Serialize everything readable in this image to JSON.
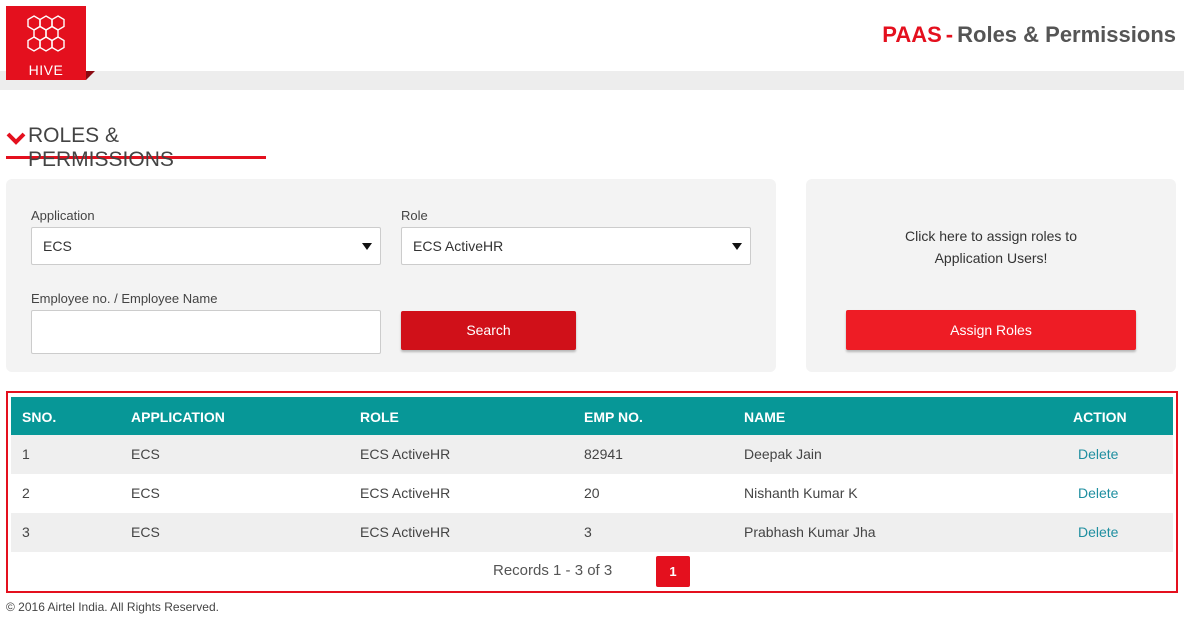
{
  "header": {
    "logo_text": "HIVE",
    "title_brand": "PAAS",
    "title_separator": "-",
    "title_text": "Roles & Permissions"
  },
  "section": {
    "title": "ROLES & PERMISSIONS"
  },
  "filters": {
    "application_label": "Application",
    "application_value": "ECS",
    "role_label": "Role",
    "role_value": "ECS ActiveHR",
    "employee_label": "Employee no. / Employee Name",
    "employee_value": "",
    "search_label": "Search"
  },
  "assign": {
    "text_line1": "Click here to assign roles to",
    "text_line2": "Application Users!",
    "button_label": "Assign Roles"
  },
  "table": {
    "columns": [
      "SNO.",
      "APPLICATION",
      "ROLE",
      "EMP NO.",
      "NAME",
      "ACTION"
    ],
    "rows": [
      {
        "sno": "1",
        "application": "ECS",
        "role": "ECS ActiveHR",
        "emp_no": "82941",
        "name": "Deepak Jain",
        "action": "Delete"
      },
      {
        "sno": "2",
        "application": "ECS",
        "role": "ECS ActiveHR",
        "emp_no": "20",
        "name": "Nishanth Kumar K",
        "action": "Delete"
      },
      {
        "sno": "3",
        "application": "ECS",
        "role": "ECS ActiveHR",
        "emp_no": "3",
        "name": "Prabhash Kumar Jha",
        "action": "Delete"
      }
    ],
    "records_text": "Records 1 - 3 of 3",
    "current_page": "1"
  },
  "footer": {
    "copyright": "© 2016 Airtel India. All Rights Reserved."
  },
  "colors": {
    "brand_red": "#e4101e",
    "table_header": "#079797",
    "link": "#1f8fa0"
  },
  "icons": {
    "logo": "hexagon-cluster-icon",
    "section": "chevron-down-icon",
    "select": "caret-down-icon"
  }
}
